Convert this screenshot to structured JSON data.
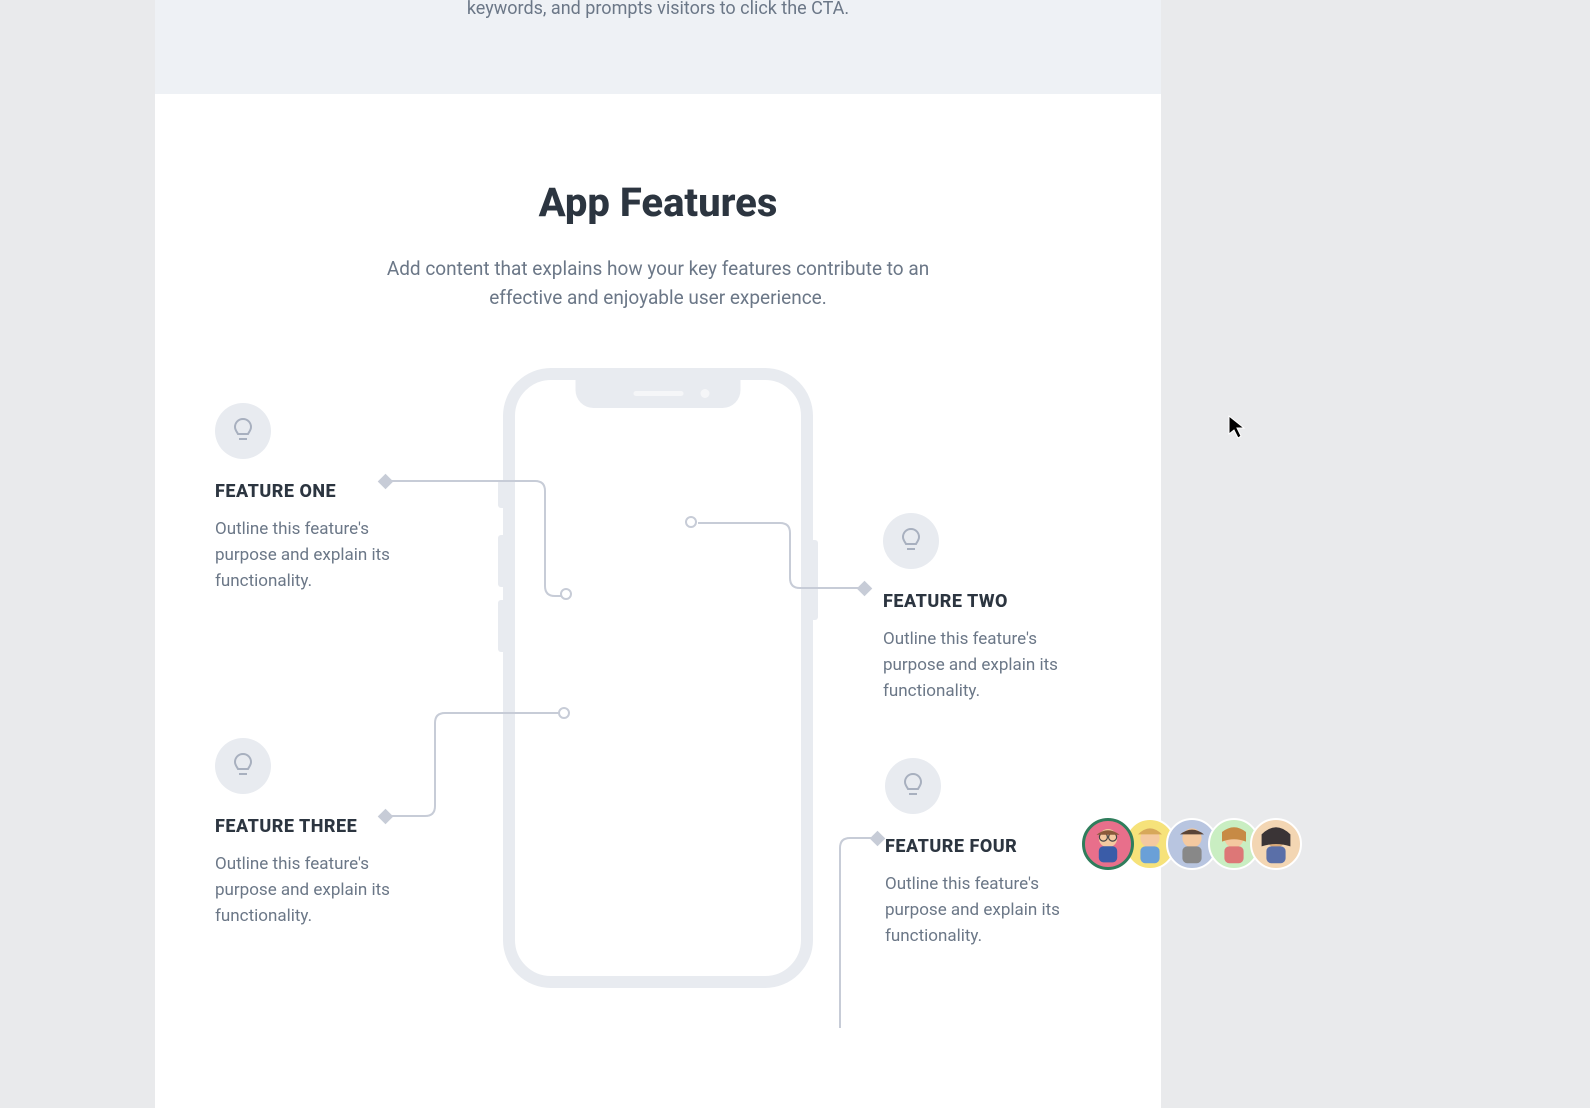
{
  "hero": {
    "partial_text": "keywords, and prompts visitors to click the CTA."
  },
  "features": {
    "heading": "App Features",
    "subtitle": "Add content that explains how your key features contribute to an effective and enjoyable user experience.",
    "items": [
      {
        "title": "FEATURE ONE",
        "desc": "Outline this feature's purpose and explain its functionality."
      },
      {
        "title": "FEATURE TWO",
        "desc": "Outline this feature's purpose and explain its functionality."
      },
      {
        "title": "FEATURE THREE",
        "desc": "Outline this feature's purpose and explain its functionality."
      },
      {
        "title": "FEATURE FOUR",
        "desc": "Outline this feature's purpose and explain its functionality."
      }
    ]
  },
  "avatars": {
    "colors": [
      "#e86f8b",
      "#f6e27a",
      "#b8c5e0",
      "#c9eec2",
      "#f3d6b3"
    ]
  }
}
